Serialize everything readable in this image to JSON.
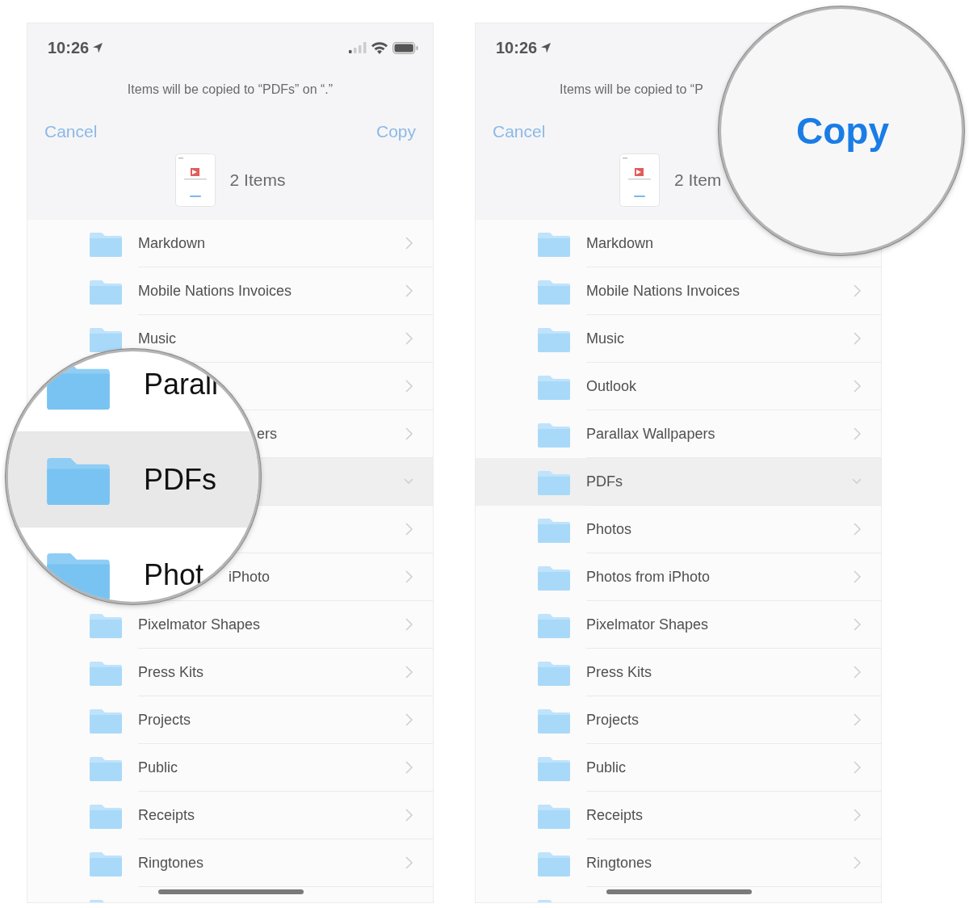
{
  "phones": [
    {
      "status_bar": {
        "time": "10:26",
        "status_icons": true
      },
      "header": {
        "message": "Items will be copied to “PDFs” on “.”",
        "cancel": "Cancel",
        "copy": "Copy",
        "item_count": "2 Items"
      },
      "rows": [
        {
          "label": "Markdown",
          "selected": false
        },
        {
          "label": "Mobile Nations Invoices",
          "selected": false
        },
        {
          "label": "Music",
          "selected": false
        },
        {
          "selected": false
        },
        {
          "label": "ers",
          "selected": false
        },
        {
          "selected": true
        },
        {
          "selected": false
        },
        {
          "label": "iPhoto",
          "selected": false
        },
        {
          "label": "Pixelmator Shapes",
          "selected": false
        },
        {
          "label": "Press Kits",
          "selected": false
        },
        {
          "label": "Projects",
          "selected": false
        },
        {
          "label": "Public",
          "selected": false
        },
        {
          "label": "Receipts",
          "selected": false
        },
        {
          "label": "Ringtones",
          "selected": false
        },
        {
          "selected": false
        }
      ],
      "magnifier": {
        "kind": "rows",
        "rows": [
          {
            "label": "Parall",
            "selected": false
          },
          {
            "label": "PDFs",
            "selected": true
          },
          {
            "label": "Phot",
            "selected": false
          }
        ]
      }
    },
    {
      "status_bar": {
        "time": "10:26"
      },
      "header": {
        "message": "Items will be copied to “P",
        "cancel": "Cancel",
        "item_count": "2 Item"
      },
      "rows": [
        {
          "label": "Markdown",
          "selected": false
        },
        {
          "label": "Mobile Nations Invoices",
          "selected": false
        },
        {
          "label": "Music",
          "selected": false
        },
        {
          "label": "Outlook",
          "selected": false
        },
        {
          "label": "Parallax Wallpapers",
          "selected": false
        },
        {
          "label": "PDFs",
          "selected": true
        },
        {
          "label": "Photos",
          "selected": false
        },
        {
          "label": "Photos from iPhoto",
          "selected": false
        },
        {
          "label": "Pixelmator Shapes",
          "selected": false
        },
        {
          "label": "Press Kits",
          "selected": false
        },
        {
          "label": "Projects",
          "selected": false
        },
        {
          "label": "Public",
          "selected": false
        },
        {
          "label": "Receipts",
          "selected": false
        },
        {
          "label": "Ringtones",
          "selected": false
        },
        {
          "selected": false
        }
      ],
      "magnifier": {
        "kind": "button",
        "label": "Copy"
      }
    }
  ]
}
